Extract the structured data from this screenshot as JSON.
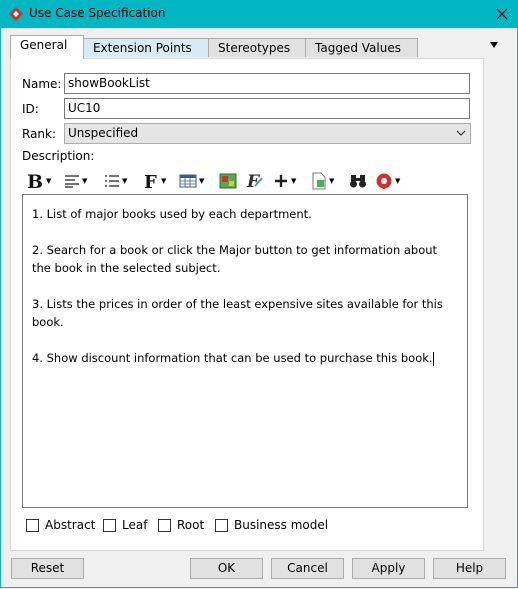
{
  "window": {
    "title": "Use Case Specification"
  },
  "tabs": [
    "General",
    "Extension Points",
    "Stereotypes",
    "Tagged Values"
  ],
  "form": {
    "name_label": "Name:",
    "name_value": "showBookList",
    "id_label": "ID:",
    "id_value": "UC10",
    "rank_label": "Rank:",
    "rank_value": "Unspecified",
    "description_label": "Description:"
  },
  "description": [
    "1. List of major books used by each department.",
    "2. Search for a book or click the Major button to get information about the book in the selected subject.",
    "3. Lists the prices in order of the least expensive sites available for this book.",
    "4. Show discount information that can be used to purchase this book."
  ],
  "toolbar": [
    "bold-icon",
    "align-icon",
    "list-icon",
    "font-icon",
    "table-icon",
    "image-icon",
    "formula-icon",
    "insert-icon",
    "document-icon",
    "find-icon",
    "spellcheck-icon"
  ],
  "checkboxes": [
    {
      "label": "Abstract",
      "checked": false
    },
    {
      "label": "Leaf",
      "checked": false
    },
    {
      "label": "Root",
      "checked": false
    },
    {
      "label": "Business model",
      "checked": false
    }
  ],
  "buttons": {
    "reset": "Reset",
    "ok": "OK",
    "cancel": "Cancel",
    "apply": "Apply",
    "help": "Help"
  },
  "colors": {
    "titlebar": "#00b7c3",
    "app_icon": "#c0392b"
  }
}
